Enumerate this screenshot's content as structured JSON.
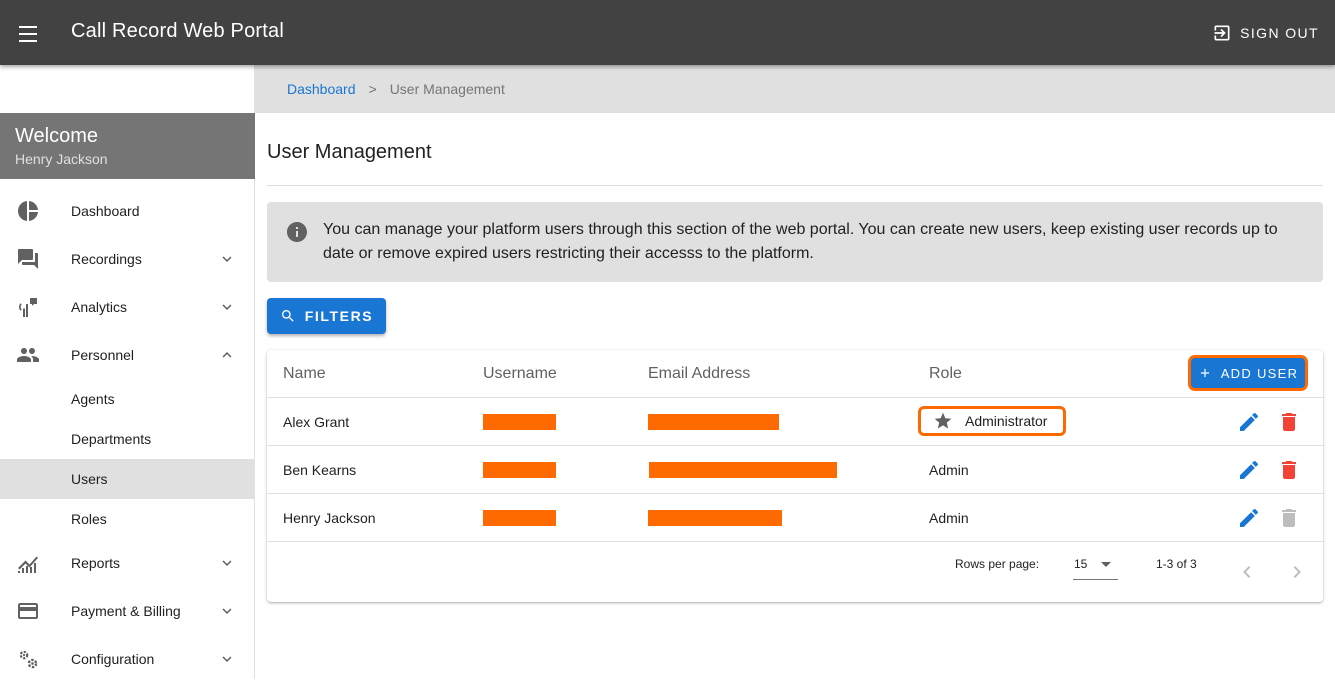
{
  "app": {
    "title": "Call Record Web Portal",
    "signout_label": "SIGN OUT"
  },
  "sidebar": {
    "welcome_title": "Welcome",
    "user_name": "Henry Jackson",
    "items": [
      {
        "label": "Dashboard",
        "icon": "pie-chart-icon"
      },
      {
        "label": "Recordings",
        "icon": "forum-icon",
        "expandable": true
      },
      {
        "label": "Analytics",
        "icon": "record-voice-icon",
        "expandable": true
      },
      {
        "label": "Personnel",
        "icon": "people-icon",
        "expanded": true,
        "children": [
          "Agents",
          "Departments",
          "Users",
          "Roles"
        ]
      },
      {
        "label": "Reports",
        "icon": "chart-line-icon",
        "expandable": true
      },
      {
        "label": "Payment & Billing",
        "icon": "credit-card-icon",
        "expandable": true
      },
      {
        "label": "Configuration",
        "icon": "settings-icon",
        "expandable": true
      }
    ],
    "active_child": "Users"
  },
  "breadcrumb": {
    "link": "Dashboard",
    "separator": ">",
    "current": "User Management"
  },
  "page": {
    "title": "User Management",
    "info": "You can manage your platform users through this section of the web portal. You can create new users, keep existing user records up to date or remove expired users restricting their accesss to the platform.",
    "filters_label": "FILTERS"
  },
  "table": {
    "headers": [
      "Name",
      "Username",
      "Email Address",
      "Role"
    ],
    "add_user_label": "ADD USER",
    "rows": [
      {
        "name": "Alex Grant",
        "role": "Administrator",
        "delete_enabled": true
      },
      {
        "name": "Ben Kearns",
        "role": "Admin",
        "delete_enabled": true
      },
      {
        "name": "Henry Jackson",
        "role": "Admin",
        "delete_enabled": false
      }
    ],
    "rows_per_page_label": "Rows per page:",
    "rows_per_page": "15",
    "range": "1-3 of 3"
  },
  "colors": {
    "appbar": "#424242",
    "primary": "#1976d2",
    "highlight": "#ff6a00",
    "delete": "#f44336",
    "disabled": "#bdbdbd"
  }
}
